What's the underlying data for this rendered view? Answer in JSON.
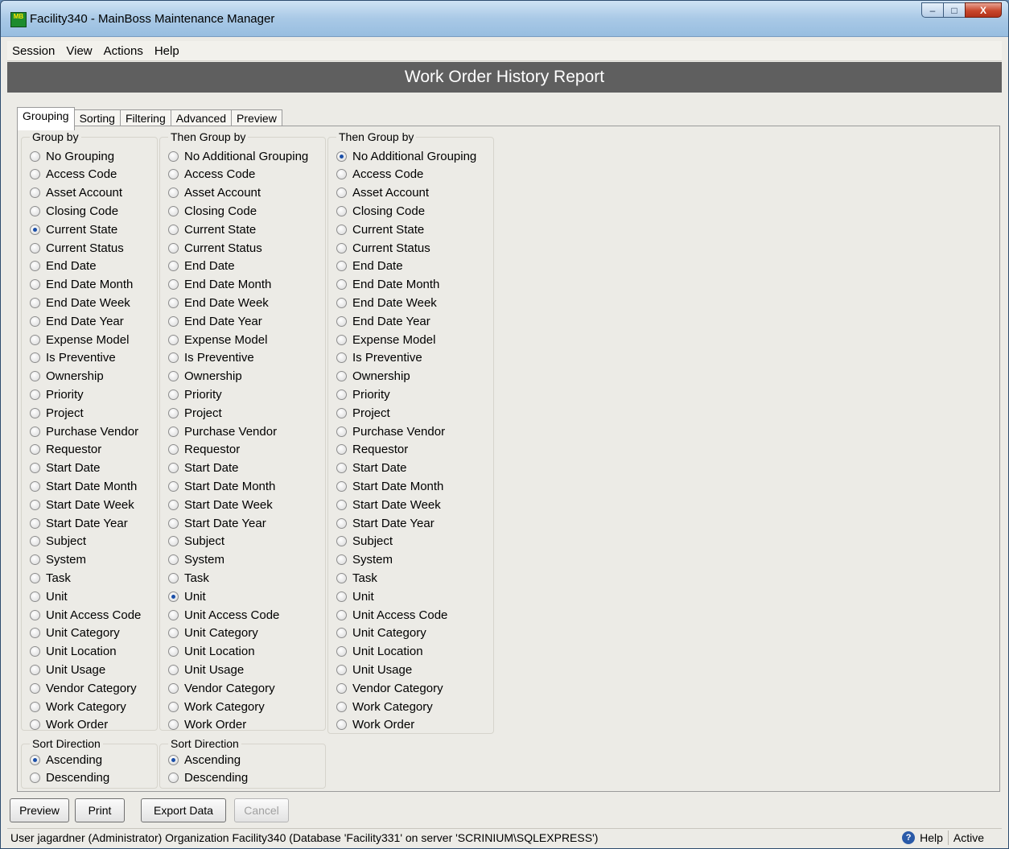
{
  "window": {
    "icon": "MB",
    "title": "Facility340 - MainBoss Maintenance Manager",
    "controls": {
      "minimize": "–",
      "maximize": "□",
      "close": "X"
    }
  },
  "menu": [
    "Session",
    "View",
    "Actions",
    "Help"
  ],
  "report_title": "Work Order History Report",
  "tabs": [
    "Grouping",
    "Sorting",
    "Filtering",
    "Advanced",
    "Preview"
  ],
  "active_tab": "Grouping",
  "group1": {
    "title": "Group by",
    "selected": "Current State",
    "options": [
      "No Grouping",
      "Access Code",
      "Asset Account",
      "Closing Code",
      "Current State",
      "Current Status",
      "End Date",
      "End Date Month",
      "End Date Week",
      "End Date Year",
      "Expense Model",
      "Is Preventive",
      "Ownership",
      "Priority",
      "Project",
      "Purchase Vendor",
      "Requestor",
      "Start Date",
      "Start Date Month",
      "Start Date Week",
      "Start Date Year",
      "Subject",
      "System",
      "Task",
      "Unit",
      "Unit Access Code",
      "Unit Category",
      "Unit Location",
      "Unit Usage",
      "Vendor Category",
      "Work Category",
      "Work Order"
    ]
  },
  "group2": {
    "title": "Then Group by",
    "selected": "Unit",
    "options": [
      "No Additional Grouping",
      "Access Code",
      "Asset Account",
      "Closing Code",
      "Current State",
      "Current Status",
      "End Date",
      "End Date Month",
      "End Date Week",
      "End Date Year",
      "Expense Model",
      "Is Preventive",
      "Ownership",
      "Priority",
      "Project",
      "Purchase Vendor",
      "Requestor",
      "Start Date",
      "Start Date Month",
      "Start Date Week",
      "Start Date Year",
      "Subject",
      "System",
      "Task",
      "Unit",
      "Unit Access Code",
      "Unit Category",
      "Unit Location",
      "Unit Usage",
      "Vendor Category",
      "Work Category",
      "Work Order"
    ]
  },
  "group3": {
    "title": "Then Group by",
    "selected": "No Additional Grouping",
    "options": [
      "No Additional Grouping",
      "Access Code",
      "Asset Account",
      "Closing Code",
      "Current State",
      "Current Status",
      "End Date",
      "End Date Month",
      "End Date Week",
      "End Date Year",
      "Expense Model",
      "Is Preventive",
      "Ownership",
      "Priority",
      "Project",
      "Purchase Vendor",
      "Requestor",
      "Start Date",
      "Start Date Month",
      "Start Date Week",
      "Start Date Year",
      "Subject",
      "System",
      "Task",
      "Unit",
      "Unit Access Code",
      "Unit Category",
      "Unit Location",
      "Unit Usage",
      "Vendor Category",
      "Work Category",
      "Work Order"
    ]
  },
  "sort1": {
    "title": "Sort Direction",
    "selected": "Ascending",
    "options": [
      "Ascending",
      "Descending"
    ]
  },
  "sort2": {
    "title": "Sort Direction",
    "selected": "Ascending",
    "options": [
      "Ascending",
      "Descending"
    ]
  },
  "buttons": {
    "preview": "Preview",
    "print": "Print",
    "export": "Export Data",
    "cancel": "Cancel"
  },
  "status": {
    "text": "User jagardner (Administrator) Organization Facility340 (Database 'Facility331' on server 'SCRINIUM\\SQLEXPRESS')",
    "help_label": "Help",
    "help_icon_glyph": "?",
    "mode": "Active",
    "help_icon": "help-circle-icon"
  }
}
